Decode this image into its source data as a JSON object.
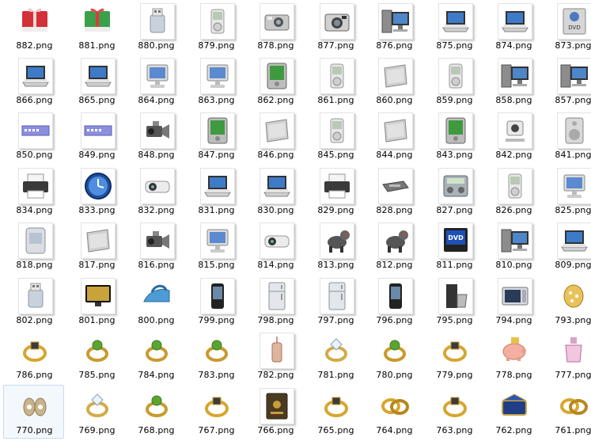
{
  "files": [
    {
      "name": "882.png",
      "icon": "red-gift-drive-icon"
    },
    {
      "name": "881.png",
      "icon": "green-gift-drive-icon"
    },
    {
      "name": "880.png",
      "icon": "usb-flash-drive-icon"
    },
    {
      "name": "879.png",
      "icon": "music-player-icon"
    },
    {
      "name": "878.png",
      "icon": "digital-camera-icon"
    },
    {
      "name": "877.png",
      "icon": "compact-camera-icon"
    },
    {
      "name": "876.png",
      "icon": "desktop-workstation-icon"
    },
    {
      "name": "875.png",
      "icon": "laptop-icon"
    },
    {
      "name": "874.png",
      "icon": "laptop-icon"
    },
    {
      "name": "873.png",
      "icon": "dvd-drive-icon"
    },
    {
      "name": "866.png",
      "icon": "laptop-icon"
    },
    {
      "name": "865.png",
      "icon": "laptop-icon"
    },
    {
      "name": "864.png",
      "icon": "desktop-monitor-icon"
    },
    {
      "name": "863.png",
      "icon": "desktop-monitor-icon"
    },
    {
      "name": "862.png",
      "icon": "pda-icon"
    },
    {
      "name": "861.png",
      "icon": "music-player-icon"
    },
    {
      "name": "860.png",
      "icon": "external-drive-icon"
    },
    {
      "name": "859.png",
      "icon": "music-player-icon"
    },
    {
      "name": "858.png",
      "icon": "desktop-workstation-icon"
    },
    {
      "name": "857.png",
      "icon": "desktop-workstation-icon"
    },
    {
      "name": "850.png",
      "icon": "network-switch-icon"
    },
    {
      "name": "849.png",
      "icon": "network-switch-icon"
    },
    {
      "name": "848.png",
      "icon": "camcorder-icon"
    },
    {
      "name": "847.png",
      "icon": "pda-icon"
    },
    {
      "name": "846.png",
      "icon": "external-drive-icon"
    },
    {
      "name": "845.png",
      "icon": "music-player-icon"
    },
    {
      "name": "844.png",
      "icon": "external-drive-icon"
    },
    {
      "name": "843.png",
      "icon": "pda-icon"
    },
    {
      "name": "842.png",
      "icon": "webcam-icon"
    },
    {
      "name": "841.png",
      "icon": "speaker-icon"
    },
    {
      "name": "834.png",
      "icon": "printer-icon"
    },
    {
      "name": "833.png",
      "icon": "clock-icon"
    },
    {
      "name": "832.png",
      "icon": "projector-icon"
    },
    {
      "name": "831.png",
      "icon": "laptop-icon"
    },
    {
      "name": "830.png",
      "icon": "laptop-icon"
    },
    {
      "name": "829.png",
      "icon": "printer-icon"
    },
    {
      "name": "828.png",
      "icon": "modem-icon"
    },
    {
      "name": "827.png",
      "icon": "radio-icon"
    },
    {
      "name": "826.png",
      "icon": "music-player-icon"
    },
    {
      "name": "825.png",
      "icon": "desktop-monitor-icon"
    },
    {
      "name": "818.png",
      "icon": "server-icon"
    },
    {
      "name": "817.png",
      "icon": "external-drive-icon"
    },
    {
      "name": "816.png",
      "icon": "camcorder-icon"
    },
    {
      "name": "815.png",
      "icon": "desktop-monitor-icon"
    },
    {
      "name": "814.png",
      "icon": "projector-icon"
    },
    {
      "name": "813.png",
      "icon": "robot-dog-icon"
    },
    {
      "name": "812.png",
      "icon": "robot-dog-icon"
    },
    {
      "name": "811.png",
      "icon": "dvd-player-icon"
    },
    {
      "name": "810.png",
      "icon": "desktop-workstation-icon"
    },
    {
      "name": "809.png",
      "icon": "laptop-icon"
    },
    {
      "name": "802.png",
      "icon": "usb-flash-drive-icon"
    },
    {
      "name": "801.png",
      "icon": "television-icon"
    },
    {
      "name": "800.png",
      "icon": "clothes-iron-icon"
    },
    {
      "name": "799.png",
      "icon": "mobile-phone-icon"
    },
    {
      "name": "798.png",
      "icon": "refrigerator-icon"
    },
    {
      "name": "797.png",
      "icon": "refrigerator-icon"
    },
    {
      "name": "796.png",
      "icon": "mobile-phone-icon"
    },
    {
      "name": "795.png",
      "icon": "coffee-maker-icon"
    },
    {
      "name": "794.png",
      "icon": "microwave-icon"
    },
    {
      "name": "793.png",
      "icon": "jewelled-egg-icon"
    },
    {
      "name": "786.png",
      "icon": "gold-ring-icon"
    },
    {
      "name": "785.png",
      "icon": "gemstone-ring-icon"
    },
    {
      "name": "784.png",
      "icon": "gemstone-ring-icon"
    },
    {
      "name": "783.png",
      "icon": "gemstone-ring-icon"
    },
    {
      "name": "782.png",
      "icon": "pendant-icon"
    },
    {
      "name": "781.png",
      "icon": "diamond-ring-icon"
    },
    {
      "name": "780.png",
      "icon": "gemstone-ring-icon"
    },
    {
      "name": "779.png",
      "icon": "gold-ring-icon"
    },
    {
      "name": "778.png",
      "icon": "piggy-bank-icon"
    },
    {
      "name": "777.png",
      "icon": "perfume-bottle-icon"
    },
    {
      "name": "770.png",
      "icon": "earrings-icon"
    },
    {
      "name": "769.png",
      "icon": "diamond-ring-icon"
    },
    {
      "name": "768.png",
      "icon": "gemstone-ring-icon"
    },
    {
      "name": "767.png",
      "icon": "gold-ring-icon"
    },
    {
      "name": "766.png",
      "icon": "safe-icon"
    },
    {
      "name": "765.png",
      "icon": "gold-ring-icon"
    },
    {
      "name": "764.png",
      "icon": "wedding-rings-icon"
    },
    {
      "name": "763.png",
      "icon": "gold-ring-icon"
    },
    {
      "name": "762.png",
      "icon": "jewelry-box-icon"
    },
    {
      "name": "761.png",
      "icon": "wedding-rings-icon"
    }
  ],
  "selected_file": "770.png"
}
